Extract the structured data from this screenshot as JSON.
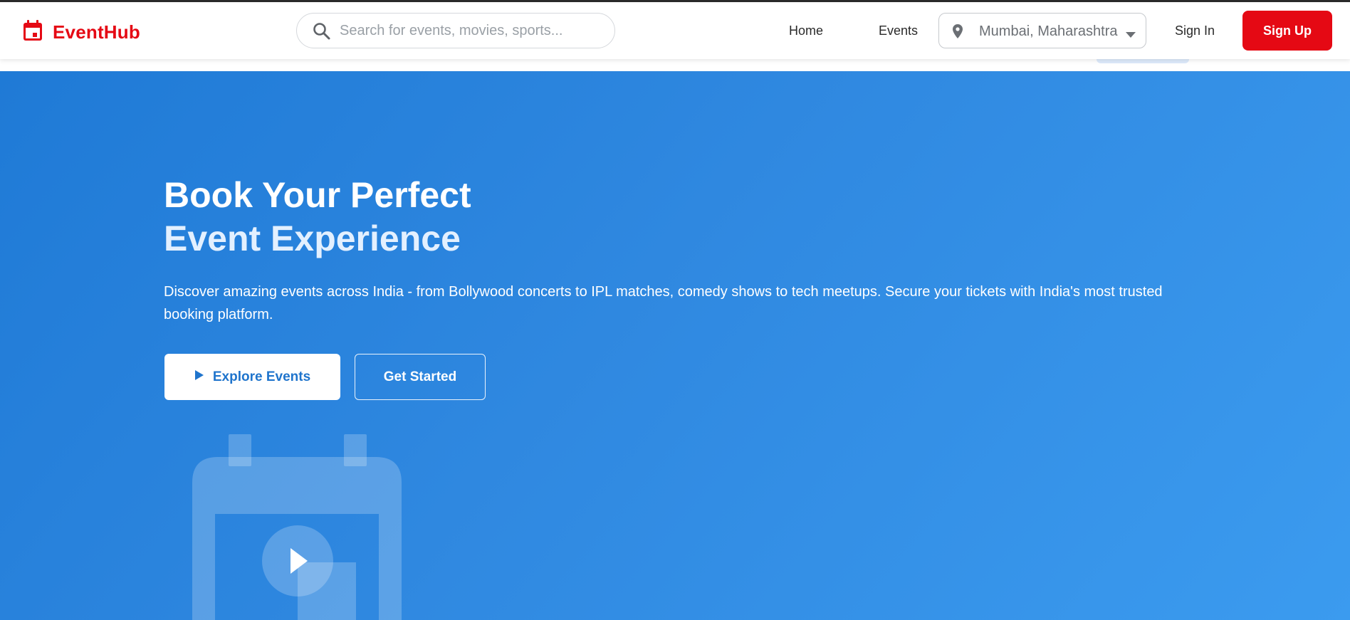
{
  "colors": {
    "brand": "#e50914",
    "hero_start": "#1f7ad6",
    "hero_end": "#3b9bef",
    "explore_text": "#1f74cc"
  },
  "header": {
    "logo_icon": "calendar-icon",
    "brand_name": "EventHub",
    "search": {
      "icon": "search-icon",
      "placeholder": "Search for events, movies, sports...",
      "value": ""
    },
    "nav": {
      "home": "Home",
      "events": "Events"
    },
    "location": {
      "icon": "map-pin-icon",
      "value": "Mumbai, Maharashtra",
      "caret_icon": "caret-down-icon"
    },
    "sign_in": "Sign In",
    "sign_up": "Sign Up"
  },
  "hero": {
    "title_line1": "Book Your Perfect",
    "title_line2": "Event Experience",
    "description": "Discover amazing events across India - from Bollywood concerts to IPL matches, comedy shows to tech meetups. Secure your tickets with India's most trusted booking platform.",
    "explore_button": {
      "icon": "play-icon",
      "label": "Explore Events"
    },
    "get_started_button": "Get Started",
    "illustration": "calendar-play-illustration"
  }
}
